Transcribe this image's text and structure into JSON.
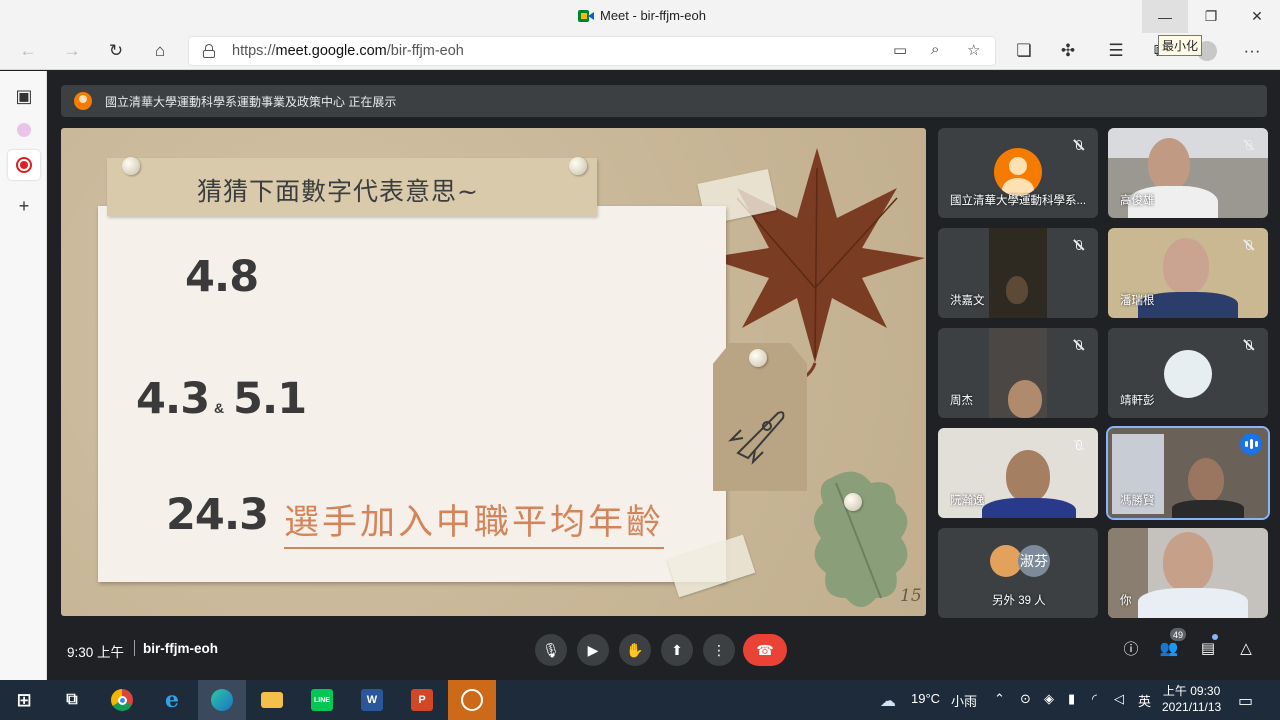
{
  "window": {
    "title": "Meet - bir-ffjm-eoh",
    "min_symbol": "—",
    "max_symbol": "❐",
    "close_symbol": "✕",
    "tooltip": "最小化"
  },
  "browser": {
    "back_icon": "←",
    "forward_icon": "→",
    "refresh_icon": "↻",
    "home_icon": "⌂",
    "url_prefix": "https://",
    "url_host": "meet.google.com",
    "url_path": "/bir-ffjm-eoh",
    "camera_icon": "▭",
    "zoom_icon": "⌕",
    "favorite_icon": "☆",
    "collections_icon": "❏",
    "extensions_icon": "✣",
    "favorites_bar_icon": "☰",
    "wallet_icon": "⧉",
    "more_icon": "···"
  },
  "edge_sidebar": {
    "tabs_icon": "▣",
    "add_icon": "+"
  },
  "banner": {
    "text": "國立清華大學運動科學系運動事業及政策中心 正在展示"
  },
  "slide": {
    "title": "猜猜下面數字代表意思~",
    "num1": "4.8",
    "num2a": "4.3",
    "amp": "&",
    "num2b": "5.1",
    "num3": "24.3",
    "answer": "選手加入中職平均年齡",
    "page": "15"
  },
  "participants": [
    {
      "name": "國立清華大學運動科學系..."
    },
    {
      "name": "高俊雄"
    },
    {
      "name": "洪嘉文"
    },
    {
      "name": "潘瑞根"
    },
    {
      "name": "周杰"
    },
    {
      "name": "靖軒彭"
    },
    {
      "name": "阮瀚逸"
    },
    {
      "name": "馮勝賢"
    },
    {
      "name": "另外 39 人",
      "extra_avatar": "淑芬"
    },
    {
      "name": "你"
    }
  ],
  "meeting_bar": {
    "time": "9:30 上午",
    "code": "bir-ffjm-eoh",
    "mic_icon": "🎙",
    "cam_icon": "▶",
    "hand_icon": "✋",
    "present_icon": "⬆",
    "more_icon": "⋮",
    "end_icon": "☎",
    "info_icon": "ⓘ",
    "people_icon": "👥",
    "people_count": "49",
    "chat_icon": "▤",
    "activities_icon": "△"
  },
  "taskbar": {
    "weather_temp": "19°C",
    "weather_text": "小雨",
    "ime": "英",
    "time": "上午 09:30",
    "date": "2021/11/13",
    "apps": [
      {
        "name": "start",
        "label": "⊞"
      },
      {
        "name": "task-view",
        "label": "⧉"
      },
      {
        "name": "chrome",
        "label": ""
      },
      {
        "name": "ie",
        "label": "e"
      },
      {
        "name": "edge",
        "label": ""
      },
      {
        "name": "explorer",
        "label": ""
      },
      {
        "name": "line",
        "label": "LINE"
      },
      {
        "name": "word",
        "label": "W"
      },
      {
        "name": "powerpoint",
        "label": "P"
      },
      {
        "name": "recorder",
        "label": ""
      }
    ]
  }
}
